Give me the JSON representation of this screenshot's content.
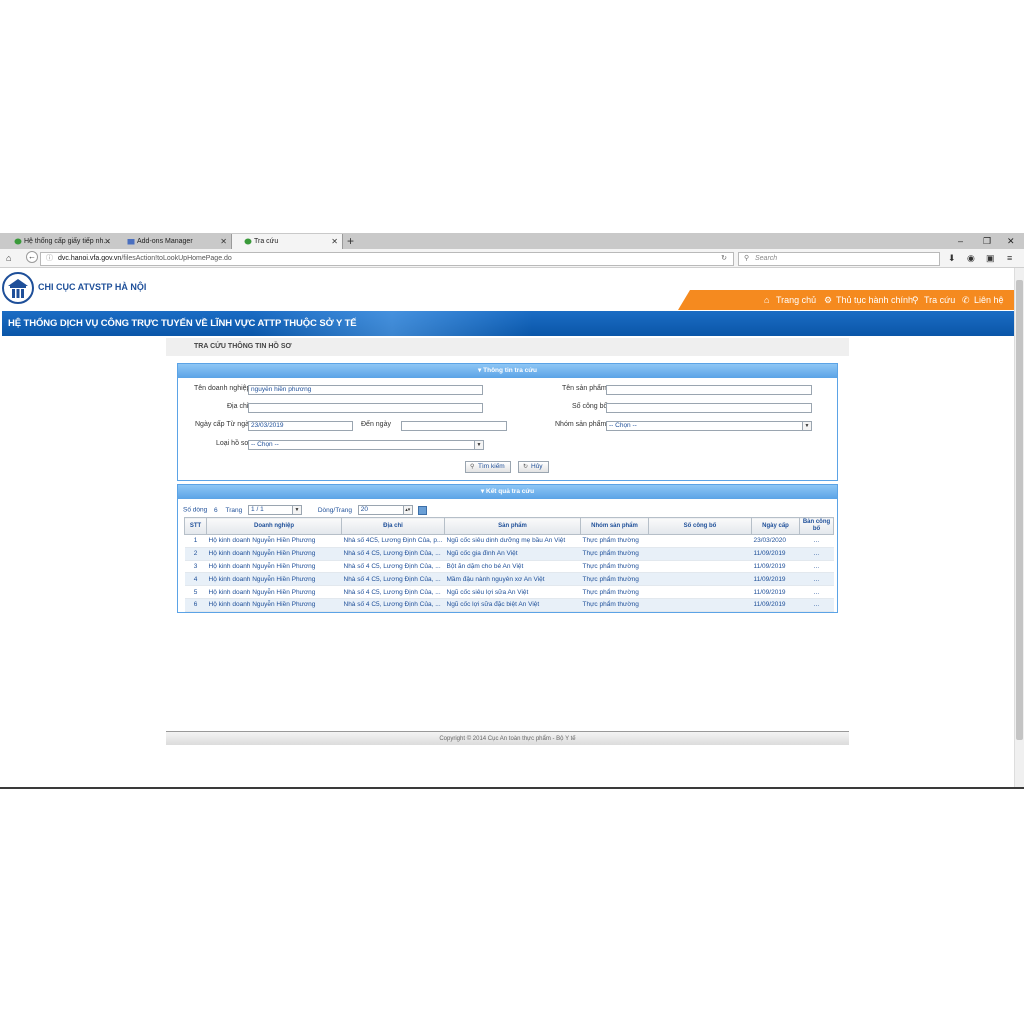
{
  "browser": {
    "tabs": [
      {
        "label": "Hệ thống cấp giấy tiếp nh...",
        "active": false
      },
      {
        "label": "Add-ons Manager",
        "active": false
      },
      {
        "label": "Tra cứu",
        "active": true
      }
    ],
    "new_tab": "+",
    "window_controls": {
      "minimize": "–",
      "restore": "❐",
      "close": "✕"
    },
    "url_host": "dvc.hanoi.vfa.gov.vn",
    "url_path": "/filesAction!toLookUpHomePage.do",
    "search_placeholder": "Search"
  },
  "header": {
    "logo_text": "CHI CỤC ATVSTP HÀ NỘI",
    "menu": [
      "Trang chủ",
      "Thủ tục hành chính",
      "Tra cứu",
      "Liên hệ"
    ],
    "banner_title": "HỆ THỐNG DỊCH VỤ CÔNG TRỰC TUYẾN VỀ LĨNH VỰC ATTP THUỘC SỞ Y TẾ",
    "colors": {
      "orange": "#f58a1f",
      "blue": "#0a56a8"
    }
  },
  "breadcrumb": "TRA CỨU THÔNG TIN HỒ SƠ",
  "search": {
    "panel_title": "Thông tin tra cứu",
    "labels": {
      "company": "Tên doanh nghiệp",
      "address": "Địa chỉ",
      "date_from": "Ngày cấp Từ ngày",
      "date_to": "Đến ngày",
      "file_type": "Loại hồ sơ",
      "product": "Tên sản phẩm",
      "announce_no": "Số công bố",
      "product_group": "Nhóm sản phẩm"
    },
    "values": {
      "company": "nguyễn hiền phương",
      "address": "",
      "date_from": "23/03/2019",
      "date_to": "",
      "file_type": "-- Chọn --",
      "product": "",
      "announce_no": "",
      "product_group": "-- Chọn --"
    },
    "search_button": "Tìm kiếm",
    "cancel_button": "Hủy"
  },
  "results": {
    "panel_title": "Kết quả tra cứu",
    "pager": {
      "rows_label": "Số dòng",
      "rows_value": "6",
      "page_label": "Trang",
      "page_value": "1 / 1",
      "per_page_label": "Dòng/Trang",
      "per_page_value": "20"
    },
    "columns": [
      "STT",
      "Doanh nghiệp",
      "Địa chỉ",
      "Sản phẩm",
      "Nhóm sản phẩm",
      "Số công bố",
      "Ngày cấp",
      "Bản công bố"
    ],
    "rows": [
      {
        "stt": "1",
        "company": "Hộ kinh doanh Nguyễn Hiền Phương",
        "address": "Nhà số 4C5, Lương Định Của, p...",
        "product": "Ngũ cốc siêu dinh dưỡng mẹ bầu An Việt",
        "group": "Thực phẩm thường",
        "number": "",
        "date": "23/03/2020",
        "doc": "..."
      },
      {
        "stt": "2",
        "company": "Hộ kinh doanh Nguyễn Hiền Phương",
        "address": "Nhà số 4 C5, Lương Định Của, ...",
        "product": "Ngũ cốc gia đình An Việt",
        "group": "Thực phẩm thường",
        "number": "",
        "date": "11/09/2019",
        "doc": "..."
      },
      {
        "stt": "3",
        "company": "Hộ kinh doanh Nguyễn Hiền Phương",
        "address": "Nhà số 4 C5, Lương Định Của, ...",
        "product": "Bột ăn dặm cho bé An Việt",
        "group": "Thực phẩm thường",
        "number": "",
        "date": "11/09/2019",
        "doc": "..."
      },
      {
        "stt": "4",
        "company": "Hộ kinh doanh Nguyễn Hiền Phương",
        "address": "Nhà số 4 C5, Lương Định Của, ...",
        "product": "Mầm đậu nành nguyên xơ An Việt",
        "group": "Thực phẩm thường",
        "number": "",
        "date": "11/09/2019",
        "doc": "..."
      },
      {
        "stt": "5",
        "company": "Hộ kinh doanh Nguyễn Hiền Phương",
        "address": "Nhà số 4 C5, Lương Định Của, ...",
        "product": "Ngũ cốc siêu lợi sữa An Việt",
        "group": "Thực phẩm thường",
        "number": "",
        "date": "11/09/2019",
        "doc": "..."
      },
      {
        "stt": "6",
        "company": "Hộ kinh doanh Nguyễn Hiền Phương",
        "address": "Nhà số 4 C5, Lương Định Của, ...",
        "product": "Ngũ cốc lợi sữa đặc biệt An Việt",
        "group": "Thực phẩm thường",
        "number": "",
        "date": "11/09/2019",
        "doc": "..."
      }
    ]
  },
  "footer": "Copyright © 2014 Cục An toàn thực phẩm - Bộ Y tế"
}
